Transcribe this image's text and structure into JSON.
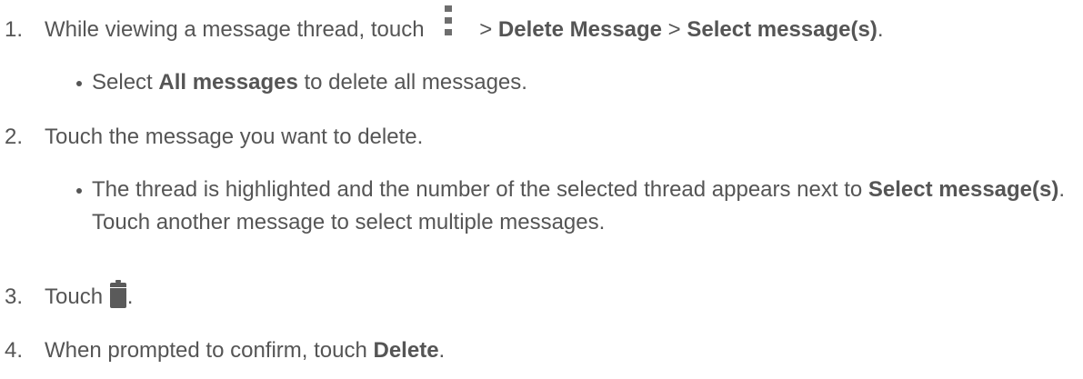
{
  "steps": [
    {
      "number": "1.",
      "text_before": "While viewing a message thread, touch",
      "icon": "menu-icon",
      "gt1": " > ",
      "bold1": "Delete Message",
      "gt2": " > ",
      "bold2": "Select message(s)",
      "text_after": ".",
      "sub": {
        "before": "Select ",
        "bold": "All messages",
        "after": " to delete all messages."
      }
    },
    {
      "number": "2.",
      "text": "Touch the message you want to delete.",
      "sub": {
        "before": "The thread is highlighted and the number of the selected thread appears next to ",
        "bold": "Select message(s)",
        "after": ". Touch another message to select multiple messages."
      }
    },
    {
      "number": "3.",
      "text_before": "Touch",
      "icon": "trash-icon",
      "text_after": "."
    },
    {
      "number": "4.",
      "text_before": "When prompted to confirm, touch ",
      "bold": "Delete",
      "text_after": "."
    }
  ]
}
